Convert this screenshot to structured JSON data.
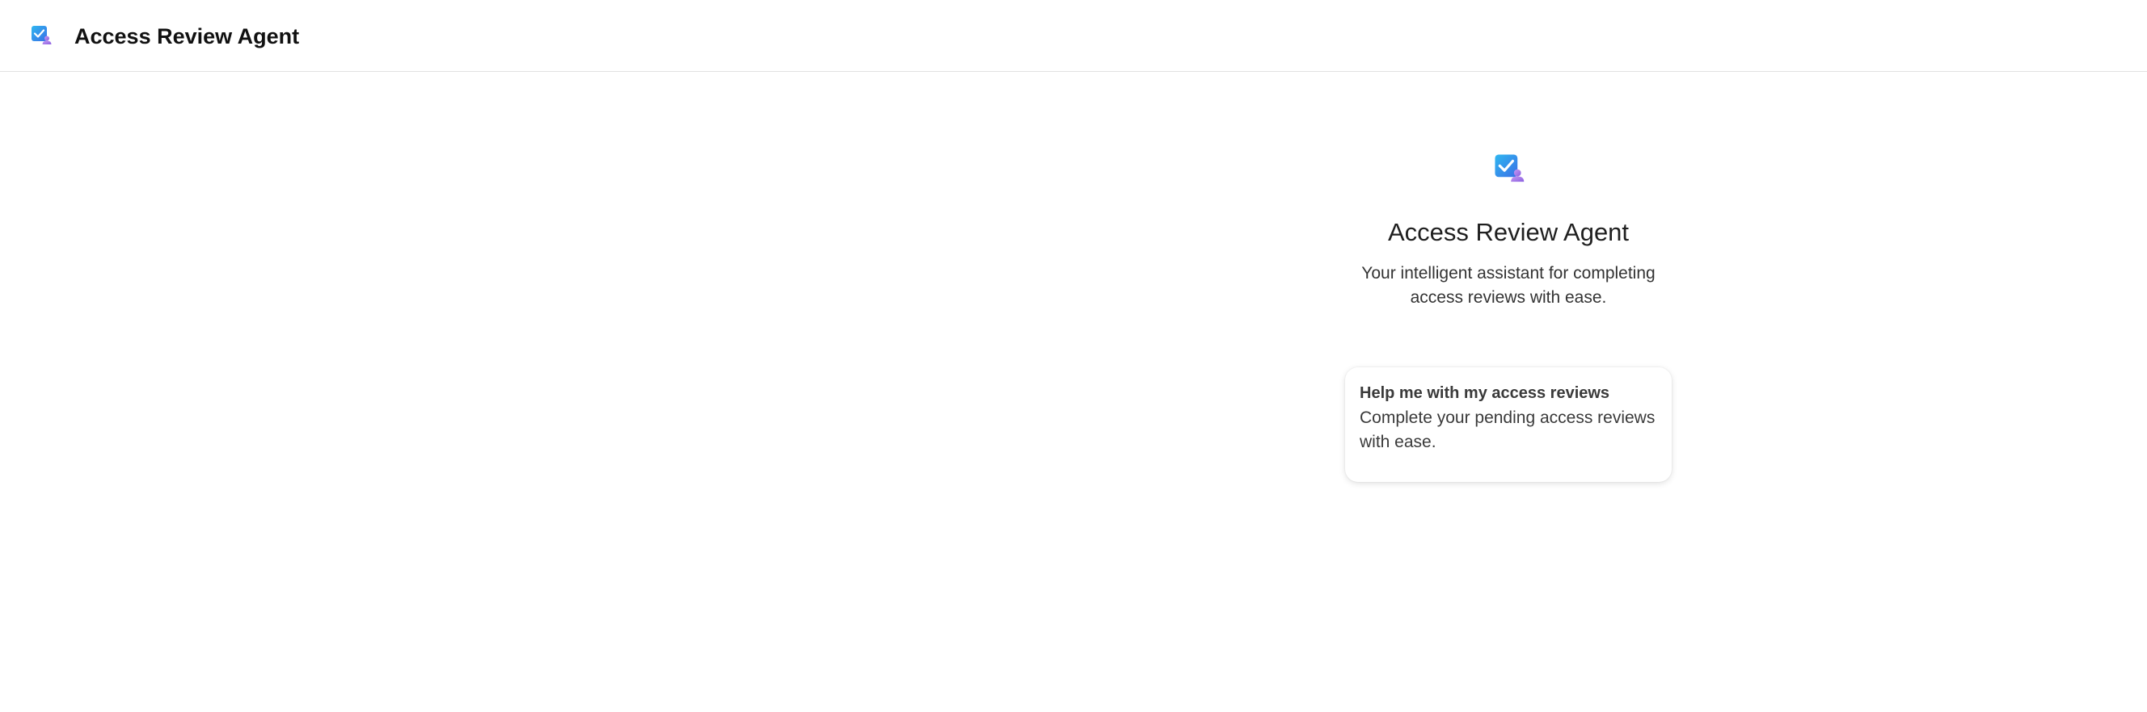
{
  "header": {
    "title": "Access Review Agent",
    "logo_icon": "access-review-agent-icon"
  },
  "hero": {
    "logo_icon": "access-review-agent-icon",
    "title": "Access Review Agent",
    "subtitle": "Your intelligent assistant for completing access reviews with ease."
  },
  "prompt_card": {
    "title": "Help me with my access reviews",
    "description": "Complete your pending access reviews with ease."
  },
  "colors": {
    "icon_gradient_start": "#2fb7f0",
    "icon_gradient_end": "#3a6fe6",
    "icon_badge": "#a879e8",
    "header_border": "#e1e1e1"
  }
}
